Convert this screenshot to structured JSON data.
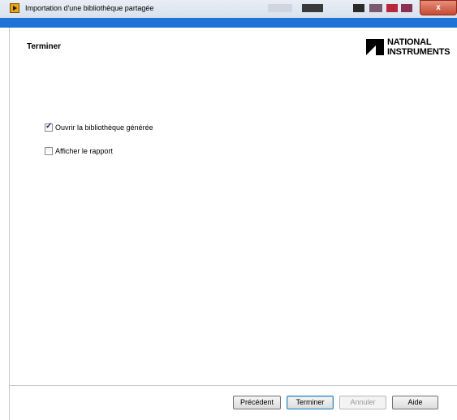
{
  "window": {
    "title": "Importation d'une bibliothèque partagée",
    "close_glyph": "x"
  },
  "header": {
    "title": "Terminer",
    "logo_line1": "NATIONAL",
    "logo_line2": "INSTRUMENTS"
  },
  "options": [
    {
      "label": "Ouvrir la bibliothèque générée",
      "checked": true
    },
    {
      "label": "Afficher le rapport",
      "checked": false
    }
  ],
  "buttons": {
    "back": "Précédent",
    "finish": "Terminer",
    "cancel": "Annuler",
    "help": "Aide"
  },
  "colors": {
    "accent": "#1e73d4",
    "close_button": "#c64a33"
  },
  "icons": [
    "labview-app-icon",
    "ni-logo-icon",
    "checkbox-checked-icon",
    "checkbox-unchecked-icon"
  ]
}
